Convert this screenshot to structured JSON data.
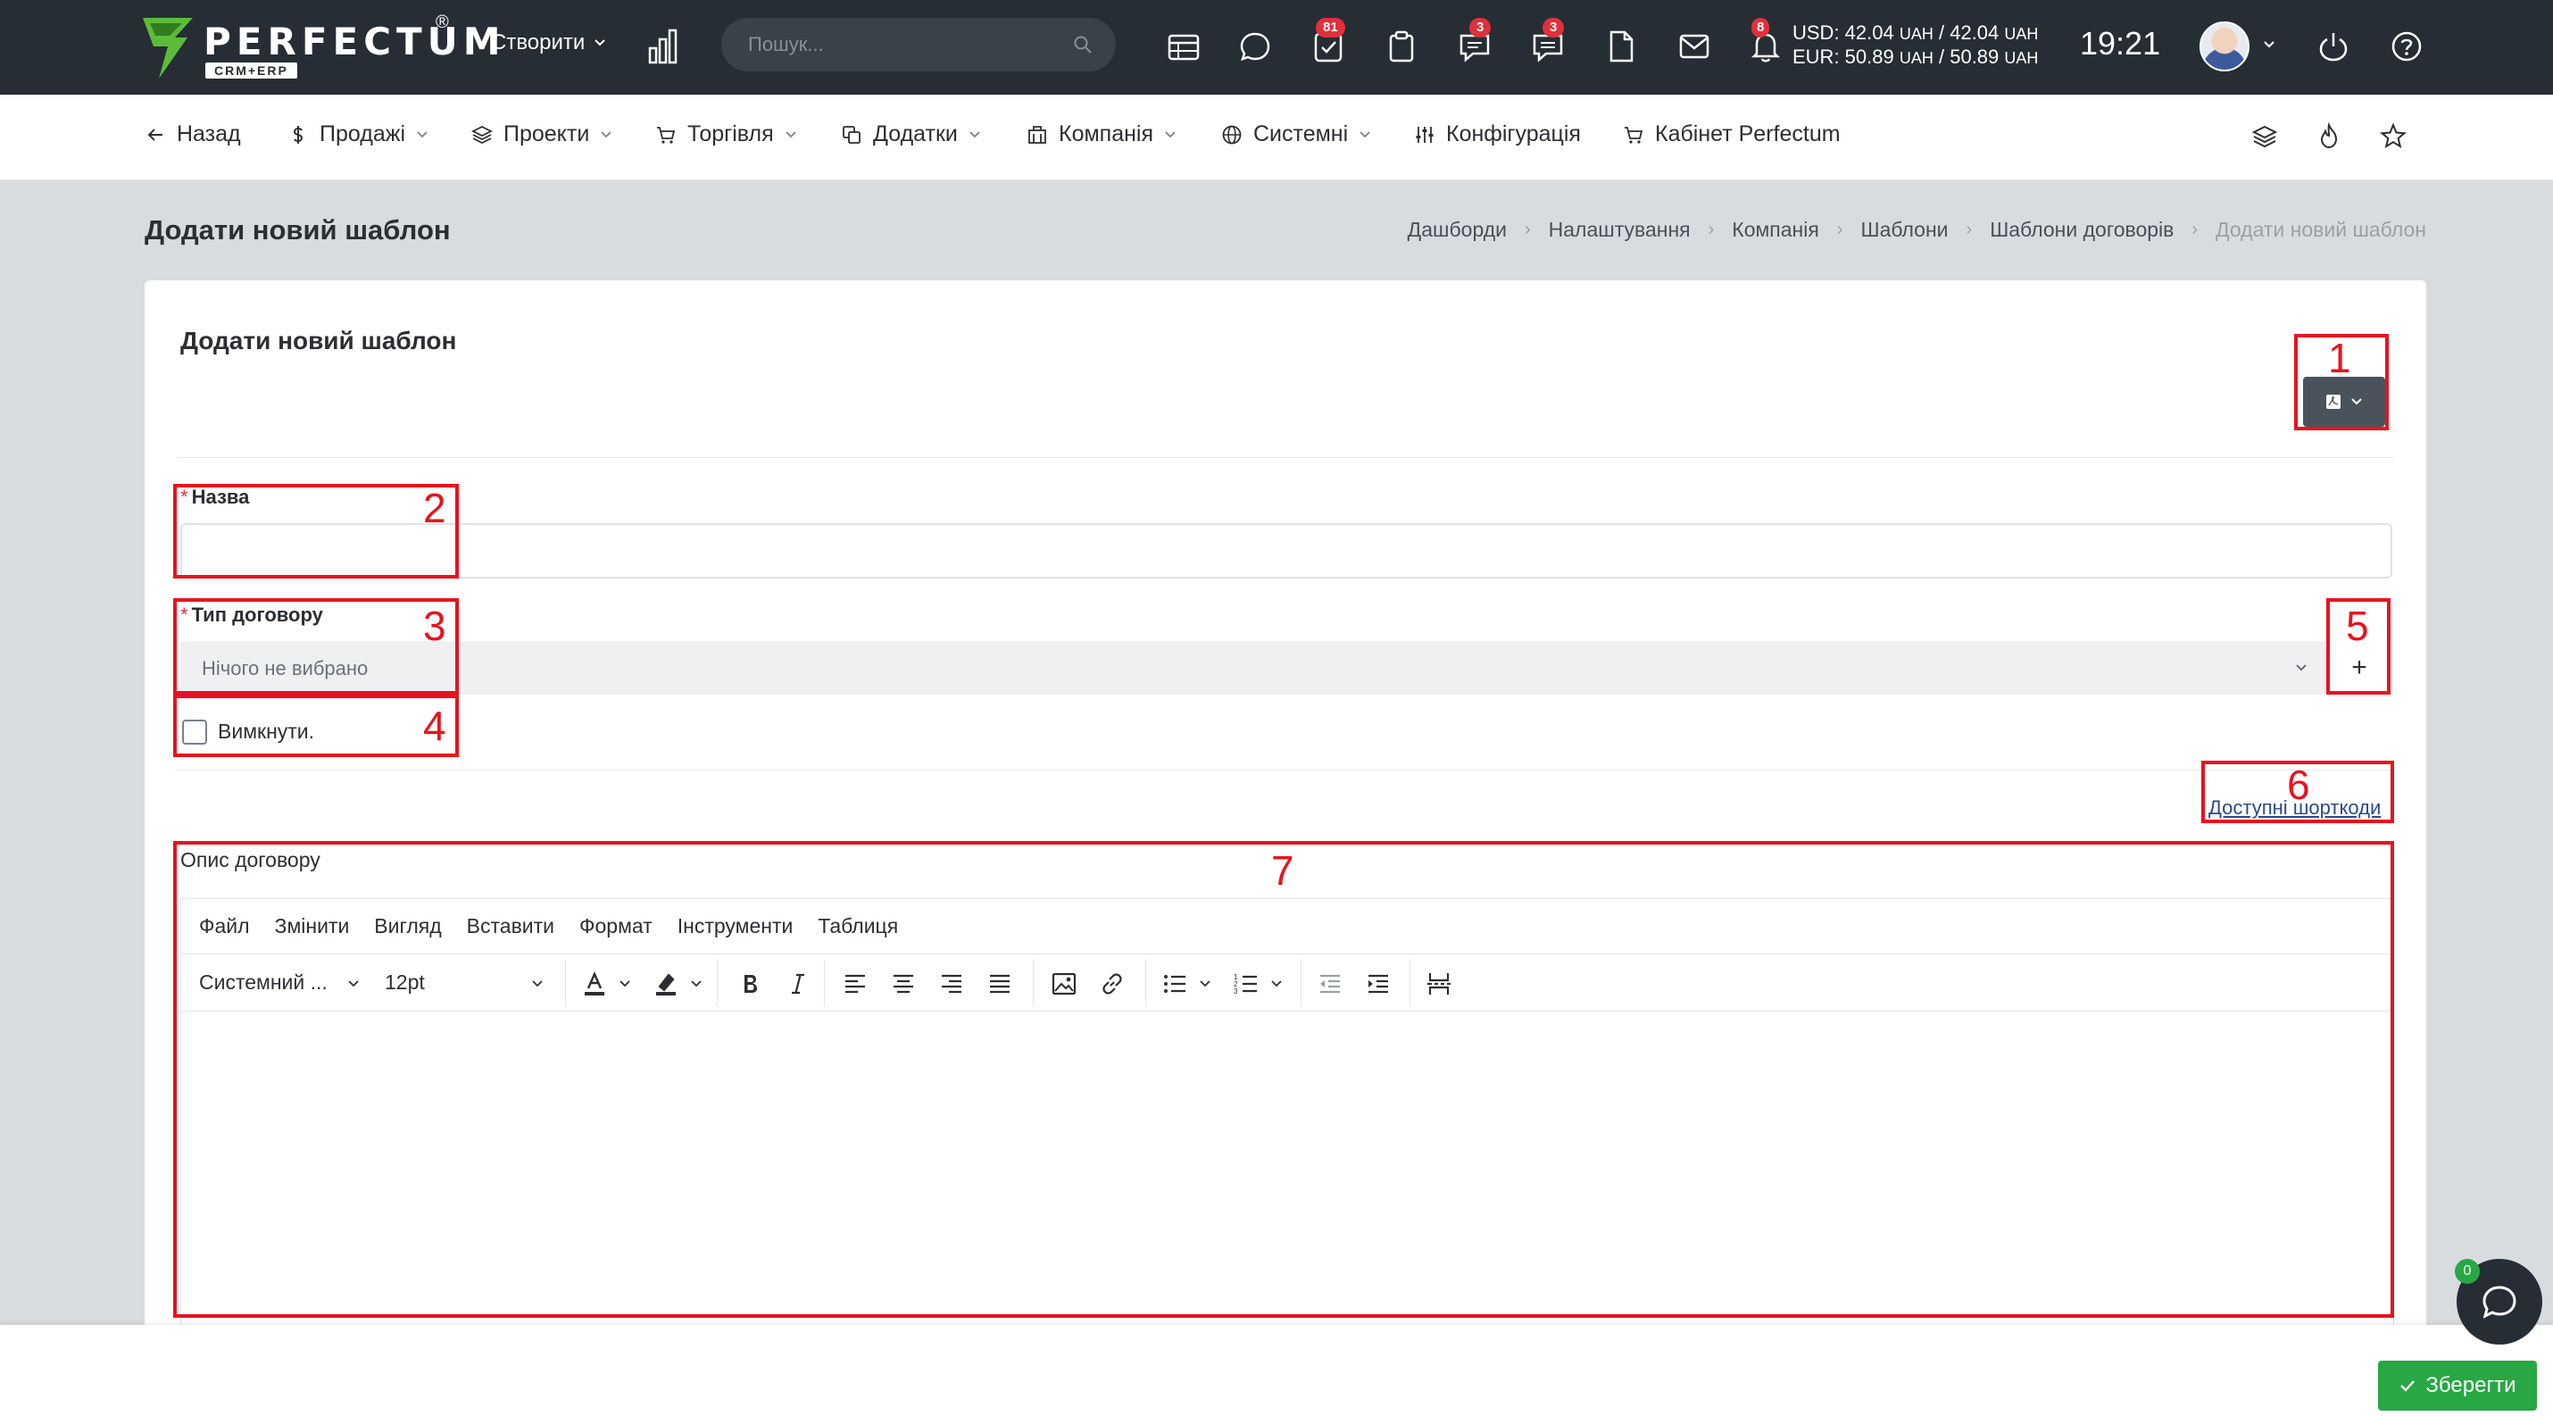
{
  "brand": {
    "name": "PERFECTUM",
    "reg": "®",
    "sub": "CRM+ERP"
  },
  "topbar": {
    "create_label": "Створити",
    "search_placeholder": "Пошук...",
    "badges": {
      "tasks": "81",
      "support": "3",
      "messages": "3",
      "notifications": "8"
    },
    "rates": {
      "usd": "USD: 42.04",
      "usd_unit1": "UAH",
      "usd_sep": "/ 42.04",
      "usd_unit2": "UAH",
      "eur": "EUR: 50.89",
      "eur_unit1": "UAH",
      "eur_sep": "/ 50.89",
      "eur_unit2": "UAH"
    },
    "time": "19:21"
  },
  "nav": {
    "back": "Назад",
    "sales": "Продажі",
    "projects": "Проекти",
    "trade": "Торгівля",
    "addons": "Додатки",
    "company": "Компанія",
    "system": "Системні",
    "config": "Конфігурація",
    "cabinet": "Кабінет Perfectum"
  },
  "page": {
    "title": "Додати новий шаблон",
    "breadcrumb": [
      "Дашборди",
      "Налаштування",
      "Компанія",
      "Шаблони",
      "Шаблони договорів",
      "Додати новий шаблон"
    ]
  },
  "form": {
    "card_title": "Додати новий шаблон",
    "required_mark": "*",
    "name_label": "Назва",
    "name_value": "",
    "type_label": "Тип договору",
    "type_placeholder": "Нічого не вибрано",
    "add_type": "+",
    "disable_label": "Вимкнути.",
    "shortcodes_link": "Доступні шорткоди",
    "description_label": "Опис договору"
  },
  "editor": {
    "menu": [
      "Файл",
      "Змінити",
      "Вигляд",
      "Вставити",
      "Формат",
      "Інструменти",
      "Таблиця"
    ],
    "font_family": "Системний ...",
    "font_size": "12pt"
  },
  "annotations": [
    "1",
    "2",
    "3",
    "4",
    "5",
    "6",
    "7"
  ],
  "footer": {
    "save": "Зберегти",
    "chat_count": "0"
  },
  "colors": {
    "topbar": "#272d34",
    "annotation": "#e8131f",
    "save": "#28a745",
    "badge": "#e0303b"
  }
}
